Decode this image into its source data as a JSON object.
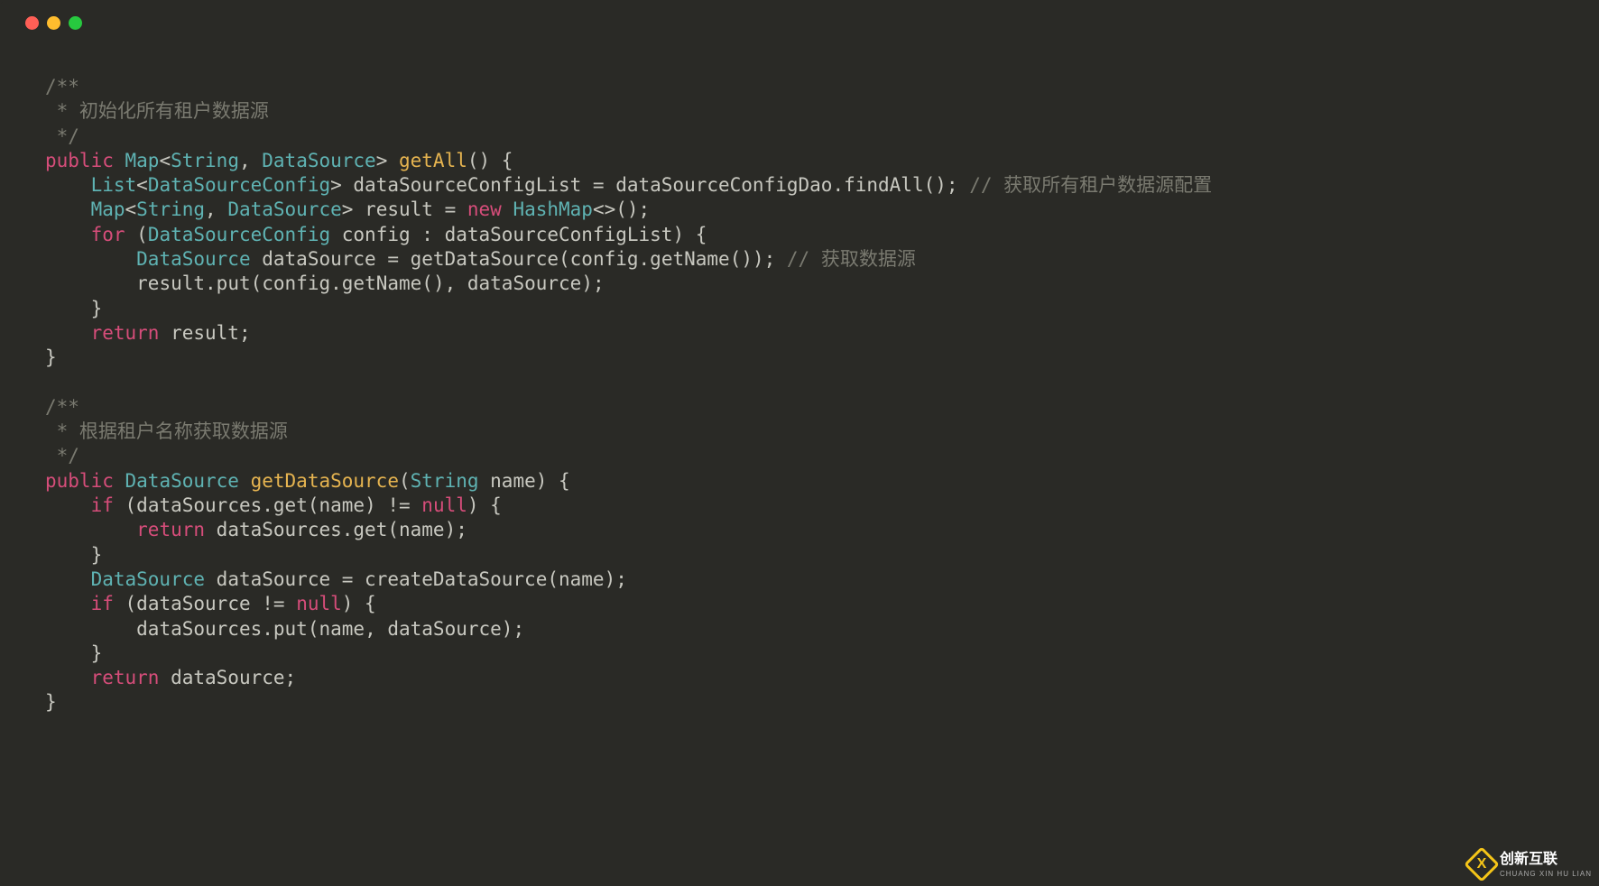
{
  "code": {
    "c1a": "/**",
    "c1b": " * 初始化所有租户数据源",
    "c1c": " */",
    "kw_public": "public",
    "ty_map": "Map",
    "ty_string": "String",
    "ty_datasource": "DataSource",
    "fn_getall": "getAll",
    "ty_list": "List",
    "ty_dsc": "DataSourceConfig",
    "id_dscl": "dataSourceConfigList",
    "id_dscdao": "dataSourceConfigDao",
    "fn_findall": "findAll",
    "c_l5": "// 获取所有租户数据源配置",
    "id_result": "result",
    "kw_new": "new",
    "ty_hashmap": "HashMap",
    "kw_for": "for",
    "id_config": "config",
    "id_ds": "dataSource",
    "fn_getds": "getDataSource",
    "fn_getname": "getName",
    "c_l8": "// 获取数据源",
    "fn_put": "put",
    "kw_return": "return",
    "c2a": "/**",
    "c2b": " * 根据租户名称获取数据源",
    "c2c": " */",
    "id_name": "name",
    "kw_if": "if",
    "id_dss": "dataSources",
    "fn_get": "get",
    "kw_null": "null",
    "fn_createds": "createDataSource"
  },
  "logo": {
    "text": "创新互联",
    "sub": "CHUANG XIN HU LIAN"
  }
}
